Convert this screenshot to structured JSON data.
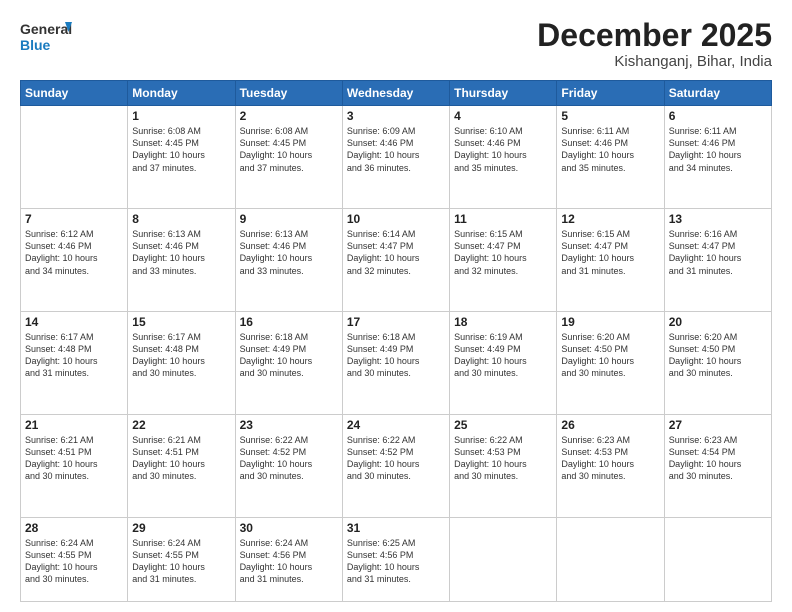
{
  "header": {
    "logo_general": "General",
    "logo_blue": "Blue",
    "month_year": "December 2025",
    "location": "Kishanganj, Bihar, India"
  },
  "calendar": {
    "days_of_week": [
      "Sunday",
      "Monday",
      "Tuesday",
      "Wednesday",
      "Thursday",
      "Friday",
      "Saturday"
    ],
    "weeks": [
      [
        {
          "day": "",
          "info": ""
        },
        {
          "day": "1",
          "info": "Sunrise: 6:08 AM\nSunset: 4:45 PM\nDaylight: 10 hours\nand 37 minutes."
        },
        {
          "day": "2",
          "info": "Sunrise: 6:08 AM\nSunset: 4:45 PM\nDaylight: 10 hours\nand 37 minutes."
        },
        {
          "day": "3",
          "info": "Sunrise: 6:09 AM\nSunset: 4:46 PM\nDaylight: 10 hours\nand 36 minutes."
        },
        {
          "day": "4",
          "info": "Sunrise: 6:10 AM\nSunset: 4:46 PM\nDaylight: 10 hours\nand 35 minutes."
        },
        {
          "day": "5",
          "info": "Sunrise: 6:11 AM\nSunset: 4:46 PM\nDaylight: 10 hours\nand 35 minutes."
        },
        {
          "day": "6",
          "info": "Sunrise: 6:11 AM\nSunset: 4:46 PM\nDaylight: 10 hours\nand 34 minutes."
        }
      ],
      [
        {
          "day": "7",
          "info": "Sunrise: 6:12 AM\nSunset: 4:46 PM\nDaylight: 10 hours\nand 34 minutes."
        },
        {
          "day": "8",
          "info": "Sunrise: 6:13 AM\nSunset: 4:46 PM\nDaylight: 10 hours\nand 33 minutes."
        },
        {
          "day": "9",
          "info": "Sunrise: 6:13 AM\nSunset: 4:46 PM\nDaylight: 10 hours\nand 33 minutes."
        },
        {
          "day": "10",
          "info": "Sunrise: 6:14 AM\nSunset: 4:47 PM\nDaylight: 10 hours\nand 32 minutes."
        },
        {
          "day": "11",
          "info": "Sunrise: 6:15 AM\nSunset: 4:47 PM\nDaylight: 10 hours\nand 32 minutes."
        },
        {
          "day": "12",
          "info": "Sunrise: 6:15 AM\nSunset: 4:47 PM\nDaylight: 10 hours\nand 31 minutes."
        },
        {
          "day": "13",
          "info": "Sunrise: 6:16 AM\nSunset: 4:47 PM\nDaylight: 10 hours\nand 31 minutes."
        }
      ],
      [
        {
          "day": "14",
          "info": "Sunrise: 6:17 AM\nSunset: 4:48 PM\nDaylight: 10 hours\nand 31 minutes."
        },
        {
          "day": "15",
          "info": "Sunrise: 6:17 AM\nSunset: 4:48 PM\nDaylight: 10 hours\nand 30 minutes."
        },
        {
          "day": "16",
          "info": "Sunrise: 6:18 AM\nSunset: 4:49 PM\nDaylight: 10 hours\nand 30 minutes."
        },
        {
          "day": "17",
          "info": "Sunrise: 6:18 AM\nSunset: 4:49 PM\nDaylight: 10 hours\nand 30 minutes."
        },
        {
          "day": "18",
          "info": "Sunrise: 6:19 AM\nSunset: 4:49 PM\nDaylight: 10 hours\nand 30 minutes."
        },
        {
          "day": "19",
          "info": "Sunrise: 6:20 AM\nSunset: 4:50 PM\nDaylight: 10 hours\nand 30 minutes."
        },
        {
          "day": "20",
          "info": "Sunrise: 6:20 AM\nSunset: 4:50 PM\nDaylight: 10 hours\nand 30 minutes."
        }
      ],
      [
        {
          "day": "21",
          "info": "Sunrise: 6:21 AM\nSunset: 4:51 PM\nDaylight: 10 hours\nand 30 minutes."
        },
        {
          "day": "22",
          "info": "Sunrise: 6:21 AM\nSunset: 4:51 PM\nDaylight: 10 hours\nand 30 minutes."
        },
        {
          "day": "23",
          "info": "Sunrise: 6:22 AM\nSunset: 4:52 PM\nDaylight: 10 hours\nand 30 minutes."
        },
        {
          "day": "24",
          "info": "Sunrise: 6:22 AM\nSunset: 4:52 PM\nDaylight: 10 hours\nand 30 minutes."
        },
        {
          "day": "25",
          "info": "Sunrise: 6:22 AM\nSunset: 4:53 PM\nDaylight: 10 hours\nand 30 minutes."
        },
        {
          "day": "26",
          "info": "Sunrise: 6:23 AM\nSunset: 4:53 PM\nDaylight: 10 hours\nand 30 minutes."
        },
        {
          "day": "27",
          "info": "Sunrise: 6:23 AM\nSunset: 4:54 PM\nDaylight: 10 hours\nand 30 minutes."
        }
      ],
      [
        {
          "day": "28",
          "info": "Sunrise: 6:24 AM\nSunset: 4:55 PM\nDaylight: 10 hours\nand 30 minutes."
        },
        {
          "day": "29",
          "info": "Sunrise: 6:24 AM\nSunset: 4:55 PM\nDaylight: 10 hours\nand 31 minutes."
        },
        {
          "day": "30",
          "info": "Sunrise: 6:24 AM\nSunset: 4:56 PM\nDaylight: 10 hours\nand 31 minutes."
        },
        {
          "day": "31",
          "info": "Sunrise: 6:25 AM\nSunset: 4:56 PM\nDaylight: 10 hours\nand 31 minutes."
        },
        {
          "day": "",
          "info": ""
        },
        {
          "day": "",
          "info": ""
        },
        {
          "day": "",
          "info": ""
        }
      ]
    ]
  }
}
